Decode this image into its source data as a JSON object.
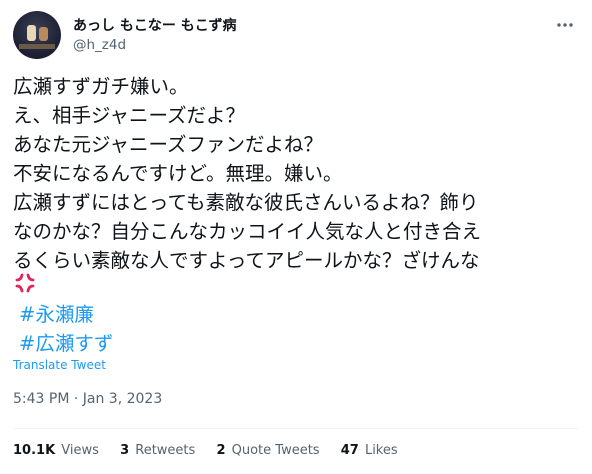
{
  "author": {
    "display_name": "あっし もこなー もこず病",
    "handle": "@h_z4d"
  },
  "tweet": {
    "lines": [
      "広瀬すずガチ嫌い。",
      "え、相手ジャニーズだよ？",
      "あなた元ジャニーズファンだよね？",
      "不安になるんですけど。無理。嫌い。",
      "広瀬すずにはとっても素敵な彼氏さんいるよね？飾り",
      "なのかな？自分こんなカッコイイ人気な人と付き合え",
      "るくらい素敵な人ですよってアピールかな？ざけんな"
    ],
    "emoji": "anger-symbol",
    "hashtags": [
      "#永瀬廉",
      "#広瀬すず"
    ]
  },
  "translate_label": "Translate Tweet",
  "timestamp": "5:43 PM · Jan 3, 2023",
  "stats": {
    "views_count": "10.1K",
    "views_label": "Views",
    "retweets_count": "3",
    "retweets_label": "Retweets",
    "quotes_count": "2",
    "quotes_label": "Quote Tweets",
    "likes_count": "47",
    "likes_label": "Likes"
  },
  "colors": {
    "link": "#1d9bf0",
    "secondary_text": "#536471",
    "primary_text": "#0f1419",
    "anger_emoji": "#e0245e"
  }
}
